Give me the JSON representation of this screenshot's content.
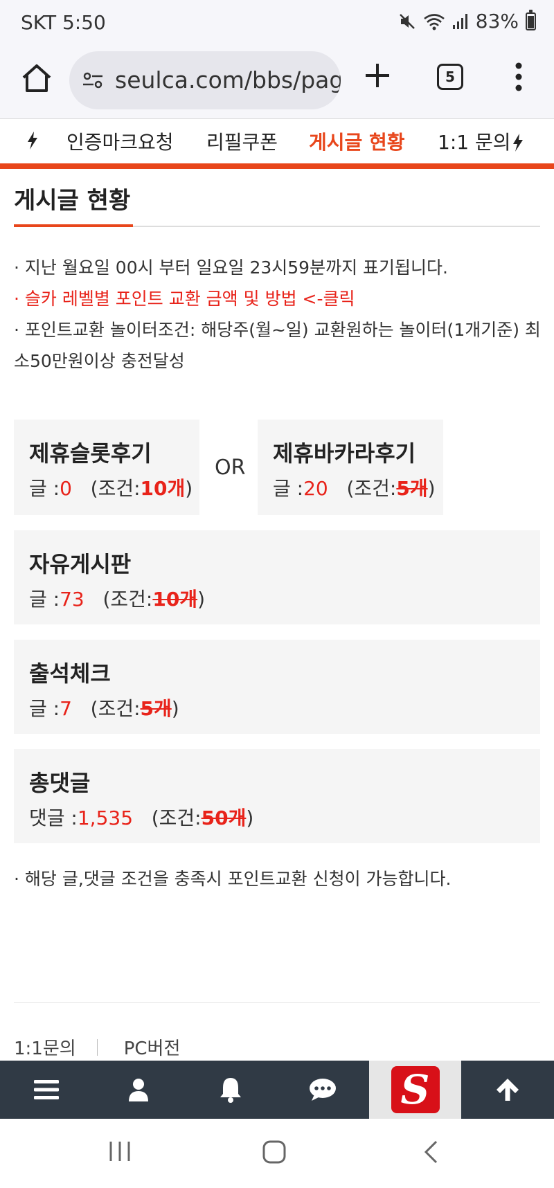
{
  "status_bar": {
    "carrier_time": "SKT 5:50",
    "battery": "83%"
  },
  "browser": {
    "url": "seulca.com/bbs/page",
    "tab_count": "5"
  },
  "nav": {
    "tabs": [
      {
        "label": "인증마크요청"
      },
      {
        "label": "리필쿠폰"
      },
      {
        "label": "게시글 현황"
      },
      {
        "label": "1:1 문의"
      }
    ]
  },
  "page": {
    "title": "게시글 현황"
  },
  "notes": {
    "line1": "· 지난 월요일 00시 부터 일요일 23시59분까지 표기됩니다.",
    "line2": "· 슬카 레벨별 포인트 교환 금액 및 방법 <-클릭",
    "line3": "· 포인트교환 놀이터조건: 해당주(월~일) 교환원하는 놀이터(1개기준) 최소50만원이상 충전달성"
  },
  "or_label": "OR",
  "boards": [
    {
      "title": "제휴슬롯후기",
      "count_label": "글 :",
      "count": "0",
      "cond_prefix": "(조건:",
      "cond": "10개",
      "cond_suffix": ")"
    },
    {
      "title": "제휴바카라후기",
      "count_label": "글 :",
      "count": "20",
      "cond_prefix": "(조건:",
      "cond": "5개",
      "cond_suffix": ")"
    },
    {
      "title": "자유게시판",
      "count_label": "글 :",
      "count": "73",
      "cond_prefix": "(조건:",
      "cond": "10개",
      "cond_suffix": ")"
    },
    {
      "title": "출석체크",
      "count_label": "글 :",
      "count": "7",
      "cond_prefix": "(조건:",
      "cond": "5개",
      "cond_suffix": ")"
    },
    {
      "title": "총댓글",
      "count_label": "댓글 :",
      "count": "1,535",
      "cond_prefix": "(조건:",
      "cond": "50개",
      "cond_suffix": ")"
    }
  ],
  "footer": {
    "note": "· 해당 글,댓글 조건을 충족시 포인트교환 신청이 가능합니다.",
    "link1": "1:1문의",
    "link2": "PC버전"
  },
  "logo": {
    "letter": "S"
  },
  "colors": {
    "accent": "#e8461b",
    "red": "#e8231a",
    "nav_bg": "#303a45"
  }
}
